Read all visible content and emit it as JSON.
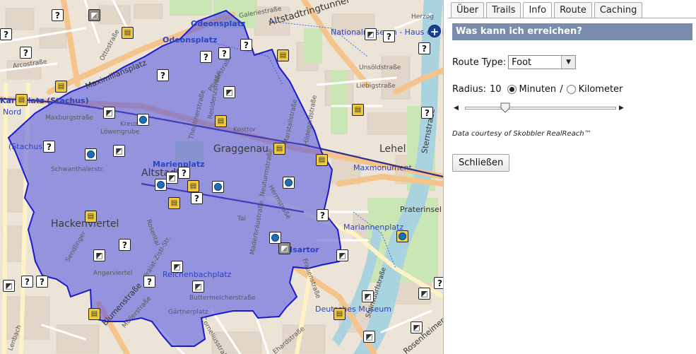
{
  "tabs": [
    {
      "label": "Über",
      "active": false
    },
    {
      "label": "Trails",
      "active": false
    },
    {
      "label": "Info",
      "active": true
    },
    {
      "label": "Route",
      "active": false
    },
    {
      "label": "Caching",
      "active": false
    }
  ],
  "panel": {
    "header": "Was kann ich erreichen?",
    "route_type_label": "Route Type:",
    "route_type_value": "Foot",
    "radius_label": "Radius:",
    "radius_value": "10",
    "unit_minutes": "Minuten",
    "unit_separator": "/",
    "unit_kilometer": "Kilometer",
    "selected_unit": "Minuten",
    "slider_fraction": 0.25,
    "credit": "Data courtesy of Skobbler RealReach™",
    "close_label": "Schließen"
  },
  "map": {
    "reach_area_color": "#4f4ee6",
    "zoom_in_symbol": "+",
    "labels": {
      "odeonsplatz_top": "Odeonsplatz",
      "odeonsplatz": "Odeonsplatz",
      "maximiliansplatz": "Maximiliansplatz",
      "karlsplatz": "Karlsplatz (Stachus)",
      "karlsplatz_short": "(Stachus)",
      "karl_nord": "Nord",
      "graggenau": "Graggenau",
      "altstadt": "Altstadt",
      "marienplatz": "Marienplatz",
      "hackenviertel": "Hackenviertel",
      "isartor": "Isartor",
      "lehel": "Lehel",
      "maxmonument": "Maxmonument",
      "praterinsel": "Praterinsel",
      "nationalmuseum": "Nationalmuseum - Haus der Kunst",
      "deutsches_museum": "Deutsches Museum",
      "galeriestrasse": "Galeriestraße",
      "altstadtring": "Altstadtringtunnel",
      "arcostrasse": "Arcostraße",
      "ottostrasse": "Ottostraße",
      "maxburgstrasse": "Maxburgstraße",
      "loewengrube": "Löwengrube",
      "kreuz": "Kreuz",
      "theatinerstrasse": "Theatinerstraße",
      "residenzstrasse": "Residenzstraße",
      "marstallstrasse": "Marstallstraße",
      "sendlinger": "Sendlinger",
      "rosental": "Rosental",
      "angerviertel": "Angerviertel",
      "reichenbachplatz": "Reichenbachplatz",
      "buttermelcherstrasse": "Buttermelcherstraße",
      "gaertnerplatz": "Gärtnerplatz",
      "muellerstrasse": "Müllerstraße",
      "blumenstrasse": "Blumenstraße",
      "frauenstrasse": "Frauenstraße",
      "steinsdorfstrasse": "Steinsdorfstraße",
      "liebigstrasse": "Liebigstraße",
      "unsoldstrasse": "Unsöldstraße",
      "sternstrasse": "Sternstraße",
      "ehardstrasse": "Ehardstraße",
      "rosenheimer": "Rosenheimer",
      "herzog": "Herzog",
      "lenbach": "Lenbach",
      "hermannstrasse": "Herrnstraße",
      "hildegardstrasse": "Hildegardstraße",
      "maderbraeustrasse": "Maderbräustraße",
      "mariannenplatz": "Mariannenplatz",
      "tal": "Tal",
      "pralat": "Prälat-Zistl-Str.",
      "cornelius": "Corneliusstraße",
      "schwanthaler": "Schwanthalerstr.",
      "kosttor": "Kosttor",
      "pfisterstrasse": "Pfisterstraße",
      "neuturm": "Neuturmstraße"
    },
    "marker_glyphs": {
      "geocache": "?",
      "multi_cache": "▤",
      "mystery_box": "◩",
      "webcam": "●"
    }
  }
}
